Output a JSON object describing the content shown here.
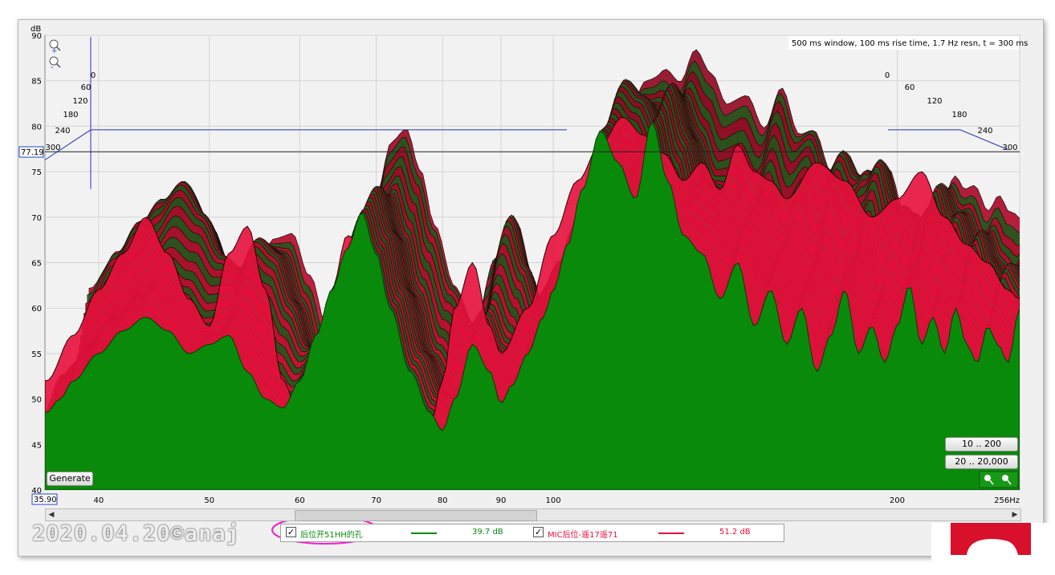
{
  "chart_data": {
    "type": "area",
    "title": "500 ms window, 100 ms rise time, 1.7 Hz resn, t = 300 ms",
    "ylabel": "dB",
    "xlabel": "Hz",
    "y_unit": "dB",
    "x_unit": "Hz",
    "ylim": [
      40,
      90
    ],
    "xlim": [
      35.9,
      256
    ],
    "x_scale": "log",
    "y_ticks": [
      40,
      45,
      50,
      55,
      60,
      65,
      70,
      75,
      80,
      85,
      90
    ],
    "x_tick_labels": [
      "40",
      "50",
      "60",
      "70",
      "80",
      "90",
      "100",
      "200",
      "256Hz"
    ],
    "x_tick_values": [
      40,
      50,
      60,
      70,
      80,
      90,
      100,
      200,
      256
    ],
    "x_min_readout": "35.90",
    "y_cursor_readout": "77.19",
    "y_cursor": 77.19,
    "time_axis_labels": [
      "0",
      "60",
      "120",
      "180",
      "240",
      "300"
    ],
    "grid": true,
    "series": [
      {
        "name": "后位开51HH的孔",
        "color": "#0a8a0a",
        "level": "39.7 dB",
        "x": [
          36,
          37,
          38,
          40,
          42,
          44,
          46,
          48,
          50,
          52,
          54,
          56,
          58,
          60,
          62,
          64,
          66,
          68,
          70,
          72,
          75,
          78,
          80,
          82,
          85,
          88,
          90,
          92,
          95,
          98,
          100,
          103,
          106,
          110,
          114,
          118,
          122,
          126,
          130,
          135,
          140,
          145,
          150,
          155,
          160,
          165,
          170,
          175,
          180,
          185,
          190,
          195,
          200,
          205,
          210,
          215,
          220,
          225,
          230,
          235,
          240,
          245,
          250,
          256
        ],
        "values": [
          48.5,
          50,
          52,
          55,
          57.5,
          59,
          57.5,
          55,
          56,
          57,
          53,
          50,
          49,
          52,
          57,
          62,
          66.5,
          70.5,
          66,
          60,
          53,
          48.5,
          46.5,
          50,
          56,
          53,
          49.5,
          51.5,
          55,
          59,
          62,
          67,
          73,
          79.5,
          76,
          72,
          80.5,
          74,
          68,
          66,
          61,
          65,
          58,
          62,
          56,
          60,
          53,
          57,
          62,
          55,
          58,
          54,
          58,
          62.5,
          56,
          59,
          55,
          60,
          56,
          54,
          58,
          56,
          54,
          60
        ]
      },
      {
        "name": "MIC后位-遥17遥71",
        "color": "#e8103c",
        "level": "51.2 dB",
        "x": [
          36,
          38,
          40,
          42,
          44,
          46,
          48,
          50,
          52,
          54,
          56,
          58,
          60,
          62,
          64,
          66,
          68,
          70,
          72,
          75,
          78,
          80,
          82,
          85,
          88,
          90,
          95,
          100,
          105,
          110,
          115,
          120,
          125,
          130,
          135,
          140,
          145,
          150,
          155,
          160,
          170,
          180,
          190,
          200,
          210,
          220,
          230,
          240,
          250,
          256
        ],
        "values": [
          52,
          57,
          62,
          66,
          70,
          66,
          61,
          58,
          66,
          69,
          62,
          52,
          48,
          55,
          62,
          68,
          67,
          62,
          56,
          50,
          47,
          52,
          60,
          65,
          58,
          55,
          60,
          68,
          74,
          78,
          81,
          79,
          77,
          74,
          76,
          73,
          78,
          75,
          74,
          72,
          76,
          74,
          70,
          72,
          75,
          70,
          67,
          65,
          62,
          61
        ]
      }
    ]
  },
  "controls": {
    "generate_label": "Generate",
    "range_button_1": "10 .. 200",
    "range_button_2": "20 .. 20,000"
  },
  "legend": {
    "item1_label": "后位开51HH的孔",
    "item1_value": "39.7 dB",
    "item1_color": "#0a8a0a",
    "item2_label": "MIC后位-遥17遥71",
    "item2_value": "51.2 dB",
    "item2_color": "#e8103c"
  },
  "watermark": "2020.04.20©anaj",
  "colors": {
    "plot_background": "#f2f2f2",
    "grid": "#d0d0d0",
    "cursor_line": "#1a1aaa",
    "green_fill": "#0a8a0a",
    "red_fill": "#e8103c",
    "logo_red": "#d8102c",
    "highlight_ellipse": "#ee22cc"
  }
}
